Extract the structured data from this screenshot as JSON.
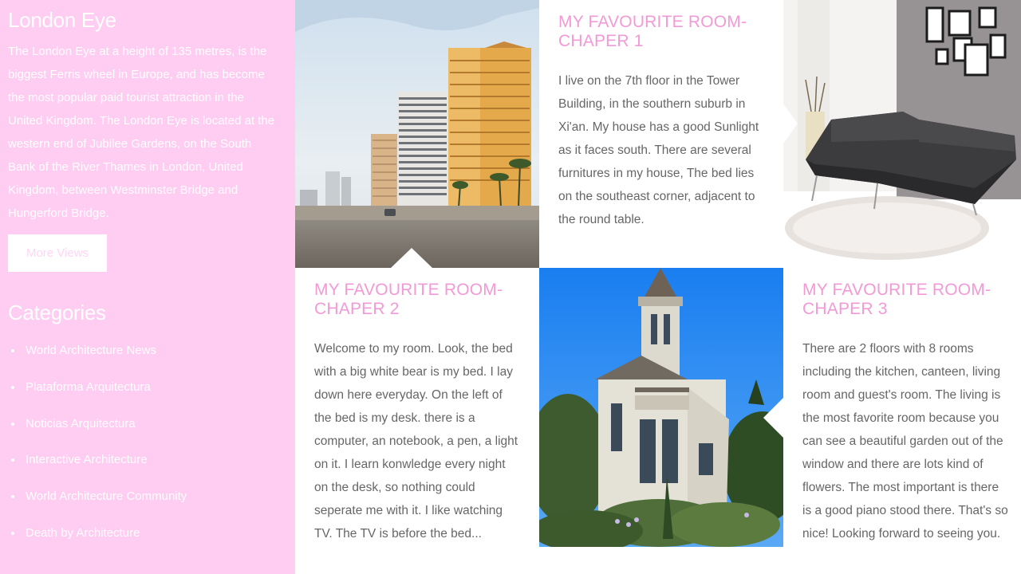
{
  "sidebar": {
    "about_title": "London Eye",
    "about_text": "The London Eye at a height of 135 metres, is the biggest Ferris wheel in Europe, and has become the most popular paid tourist attraction in the United Kingdom. The London Eye is located at the western end of Jubilee Gardens, on the South Bank of the River Thames in London, United Kingdom, between Westminster Bridge and Hungerford Bridge.",
    "more_button": "More Views",
    "categories_title": "Categories",
    "categories": [
      "World Architecture News",
      "Plataforma Arquitectura",
      "Noticias Arquitectura",
      "Interactive Architecture",
      "World Architecture Community",
      "Death by Architecture"
    ]
  },
  "posts": [
    {
      "title": "MY FAVOURITE ROOM-CHAPER 1",
      "text": "I live on the 7th floor in the Tower Building, in the southern suburb in Xi'an. My house has a good Sunlight as it faces south. There are several furnitures in my house, The bed lies on the southeast corner, adjacent to the round table."
    },
    {
      "title": "MY FAVOURITE ROOM-CHAPER 2",
      "text": "Welcome to my room. Look, the bed with a big white bear is my bed. I lay down here everyday. On the left of the bed is my desk. there is a computer, an notebook, a pen, a light on it. I learn konwledge every night on the desk, so nothing could seperate me with it. I like watching TV. The TV is before the bed..."
    },
    {
      "title": "MY FAVOURITE ROOM-CHAPER 3",
      "text": "There are 2 floors with 8 rooms including the kitchen, canteen, living room and guest's room. The living is the most favorite room because you can see a beautiful garden out of the window and there are lots kind of flowers. The most important is there is a good piano stood there. That's so nice! Looking forward to seeing you."
    }
  ],
  "colors": {
    "sidebar_bg": "#ffccf2",
    "title_pink": "#f29ad6",
    "body_text": "#666666"
  }
}
